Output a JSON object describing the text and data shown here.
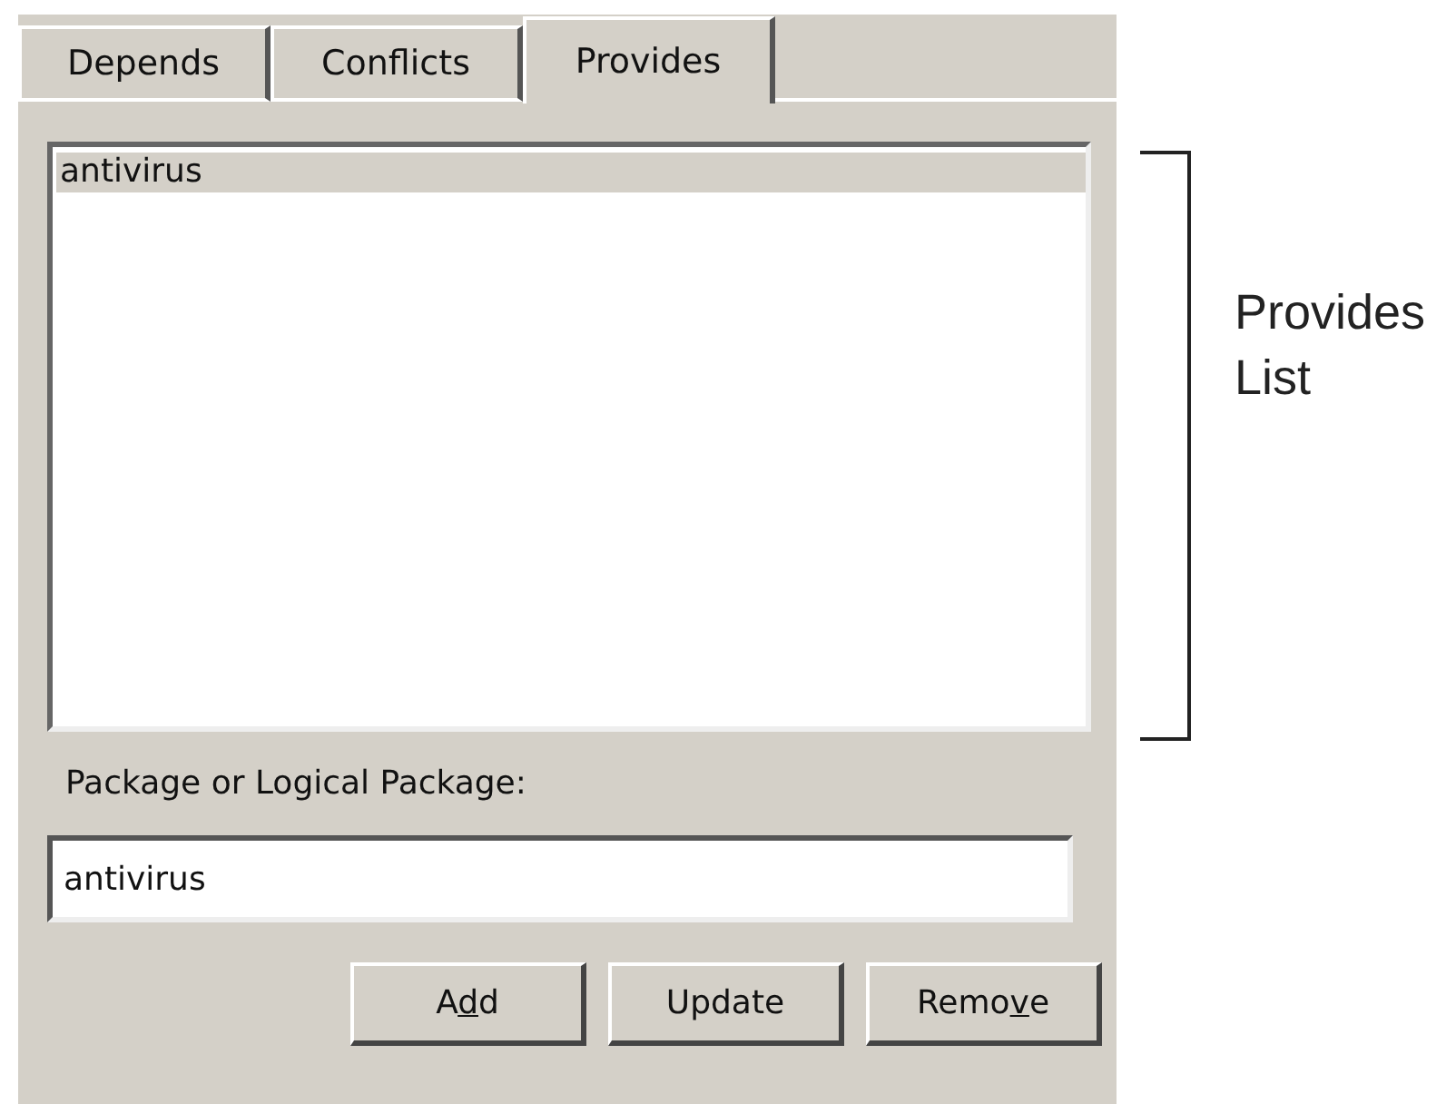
{
  "tabs": [
    {
      "label": "Depends",
      "selected": false
    },
    {
      "label": "Conflicts",
      "selected": false
    },
    {
      "label": "Provides",
      "selected": true
    }
  ],
  "list": {
    "items": [
      {
        "label": "antivirus",
        "selected": true
      }
    ]
  },
  "field": {
    "label": "Package or Logical Package:",
    "value": "antivirus"
  },
  "buttons": [
    {
      "before": "A",
      "mnemonic": "d",
      "after": "d"
    },
    {
      "before": "Update"
    },
    {
      "before": "Remo",
      "mnemonic": "v",
      "after": "e"
    }
  ],
  "annotation": {
    "text": "Provides List"
  }
}
